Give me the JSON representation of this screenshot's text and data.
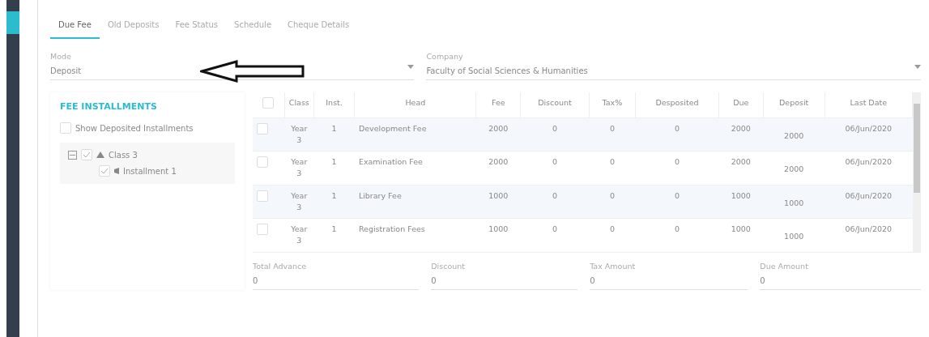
{
  "tabs": [
    {
      "label": "Due Fee",
      "selected": true
    },
    {
      "label": "Old Deposits",
      "selected": false
    },
    {
      "label": "Fee Status",
      "selected": false
    },
    {
      "label": "Schedule",
      "selected": false
    },
    {
      "label": "Cheque Details",
      "selected": false
    }
  ],
  "mode": {
    "label": "Mode",
    "value": "Deposit"
  },
  "company": {
    "label": "Company",
    "value": "Faculty of Social Sciences & Humanities"
  },
  "fee_installments": {
    "title": "FEE INSTALLMENTS",
    "show_deposited": {
      "label": "Show Deposited Installments",
      "checked": false
    },
    "tree": [
      {
        "label": "Class 3",
        "checked": true,
        "expanded": true,
        "children": [
          {
            "label": "Installment 1",
            "checked": true
          }
        ]
      }
    ]
  },
  "table": {
    "select_all": {
      "checked": false
    },
    "columns": [
      "Class",
      "Inst.",
      "Head",
      "Fee",
      "Discount",
      "Tax%",
      "Desposited",
      "Due",
      "Deposit",
      "Last Date"
    ],
    "rows": [
      {
        "checked": false,
        "cells": [
          "Year 3",
          "1",
          "Development Fee",
          "2000",
          "0",
          "0",
          "0",
          "2000",
          "2000",
          "06/Jun/2020"
        ]
      },
      {
        "checked": false,
        "cells": [
          "Year 3",
          "1",
          "Examination Fee",
          "2000",
          "0",
          "0",
          "0",
          "2000",
          "2000",
          "06/Jun/2020"
        ]
      },
      {
        "checked": false,
        "cells": [
          "Year 3",
          "1",
          "Library Fee",
          "1000",
          "0",
          "0",
          "0",
          "1000",
          "1000",
          "06/Jun/2020"
        ]
      },
      {
        "checked": false,
        "cells": [
          "Year 3",
          "1",
          "Registration Fees",
          "1000",
          "0",
          "0",
          "0",
          "1000",
          "1000",
          "06/Jun/2020"
        ]
      }
    ]
  },
  "totals": [
    {
      "label": "Total Advance",
      "value": "0"
    },
    {
      "label": "Discount",
      "value": "0"
    },
    {
      "label": "Tax Amount",
      "value": "0"
    },
    {
      "label": "Due Amount",
      "value": "0"
    }
  ]
}
